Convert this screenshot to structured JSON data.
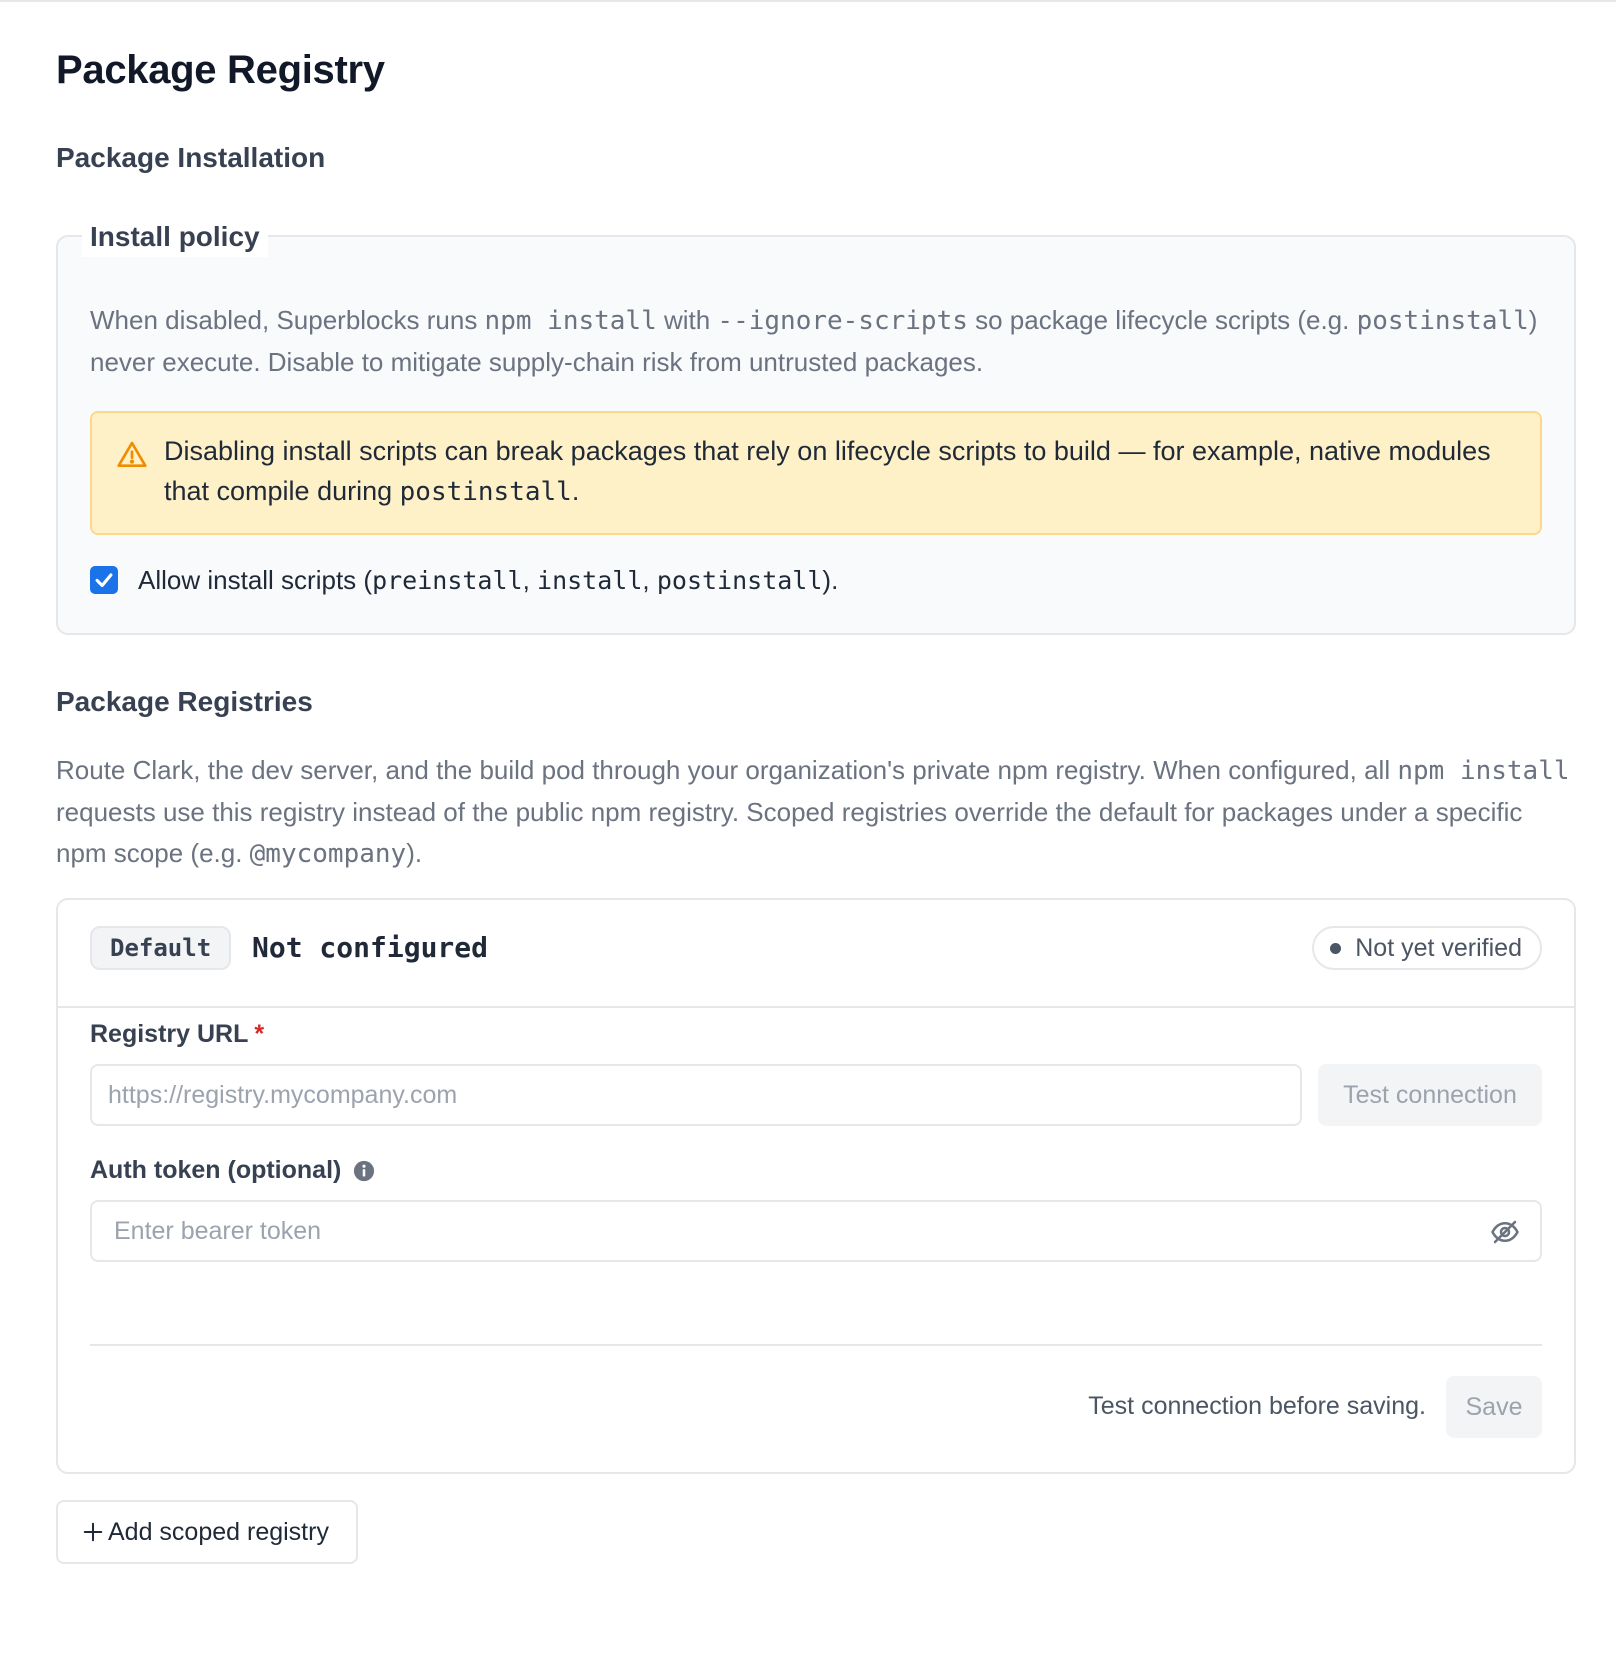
{
  "page": {
    "title": "Package Registry"
  },
  "installation": {
    "section_title": "Package Installation",
    "legend": "Install policy",
    "desc_1": "When disabled, Superblocks runs ",
    "desc_code_1": "npm install",
    "desc_2": " with ",
    "desc_code_2": "--ignore-scripts",
    "desc_3": " so package lifecycle scripts (e.g. ",
    "desc_code_3": "postinstall",
    "desc_4": ") never execute. Disable to mitigate supply-chain risk from untrusted packages.",
    "warning_1": "Disabling install scripts can break packages that rely on lifecycle scripts to build — for example, native modules that compile during ",
    "warning_code": "postinstall",
    "warning_2": ".",
    "checkbox_label_1": "Allow install scripts (",
    "checkbox_code_1": "preinstall",
    "checkbox_sep_1": ", ",
    "checkbox_code_2": "install",
    "checkbox_sep_2": ", ",
    "checkbox_code_3": "postinstall",
    "checkbox_label_2": ").",
    "checkbox_checked": true
  },
  "registries": {
    "section_title": "Package Registries",
    "desc_1": "Route Clark, the dev server, and the build pod through your organization's private npm registry. When configured, all ",
    "desc_code_1": "npm install",
    "desc_2": " requests use this registry instead of the public npm registry. Scoped registries override the default for packages under a specific npm scope (e.g. ",
    "desc_code_2": "@mycompany",
    "desc_3": ").",
    "card": {
      "badge": "Default",
      "status_text": "Not configured",
      "verify_status": "Not yet verified",
      "url_label": "Registry URL",
      "required_mark": "*",
      "url_placeholder": "https://registry.mycompany.com",
      "test_button": "Test connection",
      "token_label": "Auth token (optional)",
      "token_placeholder": "Enter bearer token",
      "save_hint": "Test connection before saving.",
      "save_button": "Save"
    },
    "add_button": "Add scoped registry"
  },
  "colors": {
    "accent": "#1a73e8",
    "warning_bg": "#fef0c7",
    "warning_border": "#fcd98a",
    "warning_icon": "#f08c00",
    "required": "#dc2626"
  },
  "icons": {
    "warning": "warning-triangle-icon",
    "check": "check-icon",
    "info": "info-icon",
    "eye": "eye-off-icon",
    "plus": "plus-icon"
  }
}
